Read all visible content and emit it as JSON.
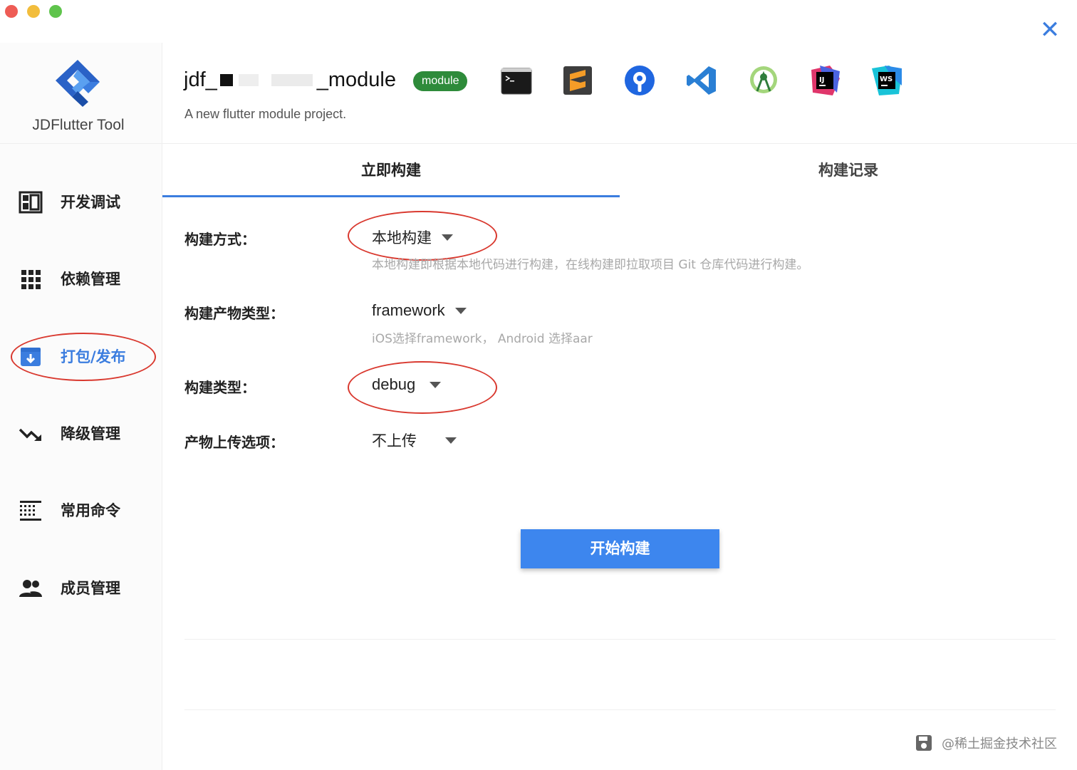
{
  "app": {
    "name": "JDFlutter Tool",
    "close_icon": "close-icon",
    "accent": "#3b7ddf"
  },
  "project": {
    "title_prefix": "jdf_",
    "title_suffix": "_module",
    "badge": "module",
    "description": "A new flutter module project."
  },
  "tools": [
    {
      "name": "terminal-icon"
    },
    {
      "name": "sublime-text-icon"
    },
    {
      "name": "sourcetree-icon"
    },
    {
      "name": "vscode-icon"
    },
    {
      "name": "android-studio-icon"
    },
    {
      "name": "intellij-idea-icon"
    },
    {
      "name": "webstorm-icon"
    }
  ],
  "sidebar": {
    "items": [
      {
        "label": "开发调试",
        "icon": "dashboard-icon"
      },
      {
        "label": "依赖管理",
        "icon": "apps-grid-icon"
      },
      {
        "label": "打包/发布",
        "icon": "package-icon",
        "active": true
      },
      {
        "label": "降级管理",
        "icon": "trending-down-icon"
      },
      {
        "label": "常用命令",
        "icon": "command-list-icon"
      },
      {
        "label": "成员管理",
        "icon": "people-icon"
      }
    ]
  },
  "tabs": [
    {
      "label": "立即构建",
      "active": true
    },
    {
      "label": "构建记录",
      "active": false
    }
  ],
  "form": {
    "build_mode": {
      "label": "构建方式：",
      "value": "本地构建",
      "hint": "本地构建即根据本地代码进行构建，在线构建即拉取项目 Git 仓库代码进行构建。"
    },
    "artifact_type": {
      "label": "构建产物类型：",
      "value": "framework",
      "hint": "iOS选择framework， Android 选择aar"
    },
    "build_type": {
      "label": "构建类型：",
      "value": "debug"
    },
    "upload_option": {
      "label": "产物上传选项：",
      "value": "不上传"
    },
    "submit_label": "开始构建"
  },
  "footer": {
    "watermark": "@稀土掘金技术社区",
    "save_icon": "save-icon"
  }
}
